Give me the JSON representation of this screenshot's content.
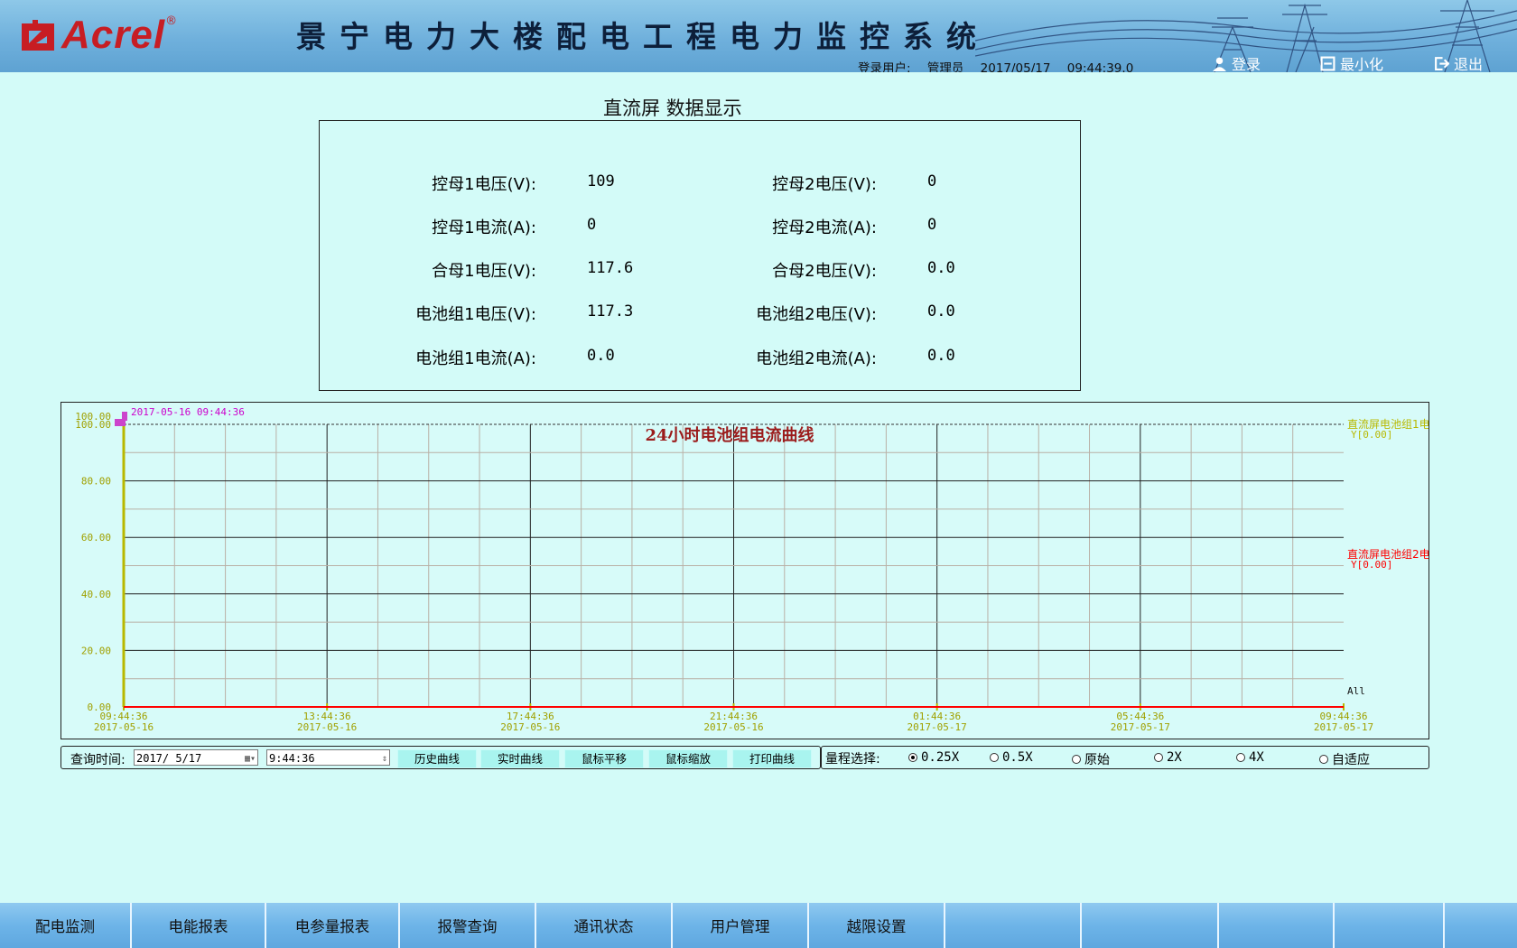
{
  "header": {
    "brand": "Acrel",
    "brand_mark": "®",
    "system_title": "景宁电力大楼配电工程电力监控系统",
    "user_label": "登录用户:",
    "user_name": "管理员",
    "date": "2017/05/17",
    "time": "09:44:39.0",
    "login_label": "登录",
    "minimize_label": "最小化",
    "exit_label": "退出"
  },
  "panel": {
    "title": "直流屏  数据显示",
    "left": [
      {
        "label": "控母1电压(V):",
        "value": "109"
      },
      {
        "label": "控母1电流(A):",
        "value": "0"
      },
      {
        "label": "合母1电压(V):",
        "value": "117.6"
      },
      {
        "label": "电池组1电压(V):",
        "value": "117.3"
      },
      {
        "label": "电池组1电流(A):",
        "value": "0.0"
      }
    ],
    "right": [
      {
        "label": "控母2电压(V):",
        "value": "0"
      },
      {
        "label": "控母2电流(A):",
        "value": "0"
      },
      {
        "label": "合母2电压(V):",
        "value": "0.0"
      },
      {
        "label": "电池组2电压(V):",
        "value": "0.0"
      },
      {
        "label": "电池组2电流(A):",
        "value": "0.0"
      }
    ]
  },
  "chart_data": {
    "type": "line",
    "title": "24小时电池组电流曲线",
    "cursor_label": "2017-05-16 09:44:36",
    "ylim": [
      0,
      100
    ],
    "y_ticks": [
      "0.00",
      "20.00",
      "40.00",
      "60.00",
      "80.00",
      "100.00"
    ],
    "y_top_label": "100.00",
    "x_ticks": [
      {
        "time": "09:44:36",
        "date": "2017-05-16"
      },
      {
        "time": "13:44:36",
        "date": "2017-05-16"
      },
      {
        "time": "17:44:36",
        "date": "2017-05-16"
      },
      {
        "time": "21:44:36",
        "date": "2017-05-16"
      },
      {
        "time": "01:44:36",
        "date": "2017-05-17"
      },
      {
        "time": "05:44:36",
        "date": "2017-05-17"
      },
      {
        "time": "09:44:36",
        "date": "2017-05-17"
      }
    ],
    "series": [
      {
        "name": "直流屏电池组1电",
        "value_label": "Y[0.00]",
        "color": "#b8b800",
        "values": [
          0,
          0,
          0,
          0,
          0,
          0,
          0
        ]
      },
      {
        "name": "直流屏电池组2电",
        "value_label": "Y[0.00]",
        "color": "#ff0000",
        "values": [
          0,
          0,
          0,
          0,
          0,
          0,
          0
        ]
      }
    ],
    "all_label": "All",
    "grid": true
  },
  "query": {
    "label": "查询时间:",
    "date_value": "2017/ 5/17",
    "time_value": "9:44:36",
    "buttons": [
      "历史曲线",
      "实时曲线",
      "鼠标平移",
      "鼠标缩放",
      "打印曲线"
    ]
  },
  "range": {
    "label": "量程选择:",
    "options": [
      "0.25X",
      "0.5X",
      "原始",
      "2X",
      "4X",
      "自适应"
    ],
    "selected": "0.25X"
  },
  "nav": {
    "items": [
      "配电监测",
      "电能报表",
      "电参量报表",
      "报警查询",
      "通讯状态",
      "用户管理",
      "越限设置",
      "",
      "",
      "",
      "",
      ""
    ]
  },
  "colors": {
    "background": "#d3fbf8",
    "header": "#6fb0dc",
    "chart_title": "#9b1b1b",
    "cursor": "#cc00cc",
    "axis_label": "#a0a000"
  }
}
